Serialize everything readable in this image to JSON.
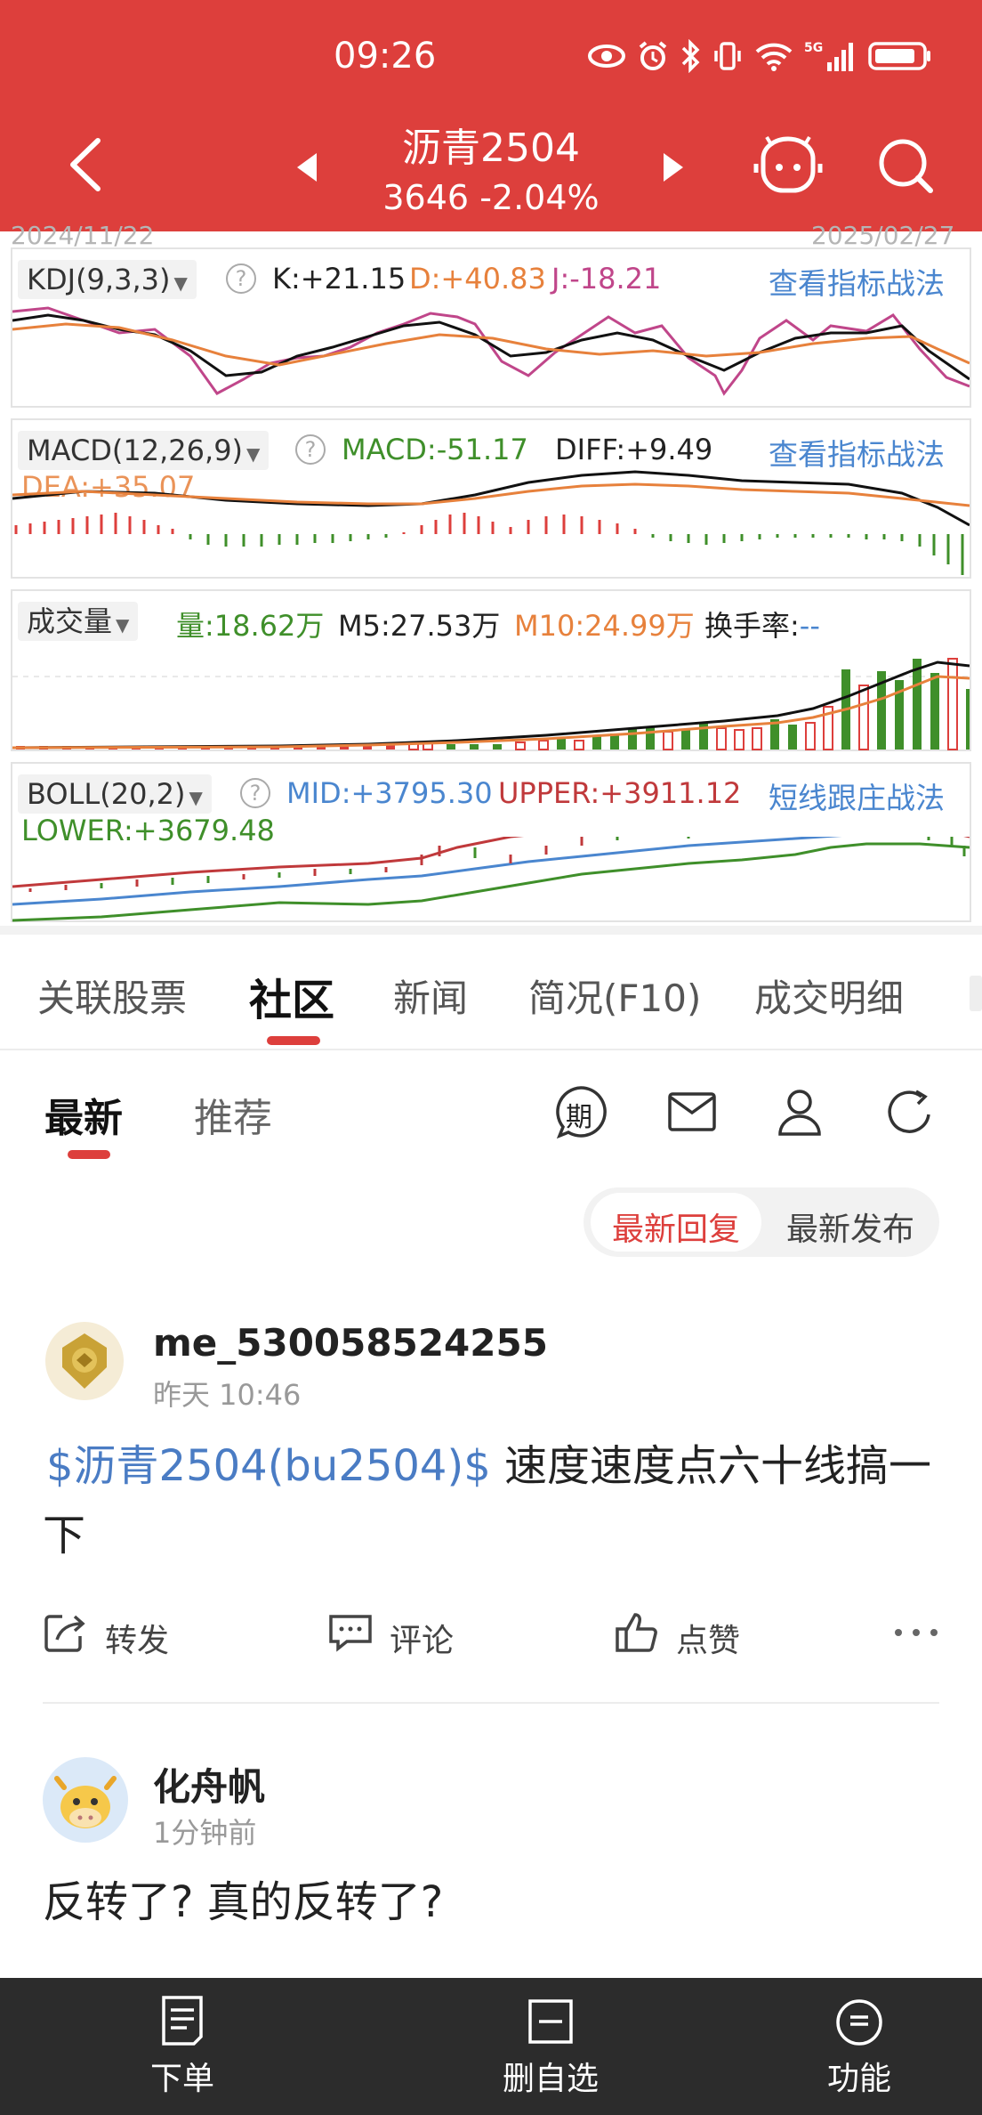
{
  "status_bar": {
    "time": "09:26",
    "icons": [
      "eye-icon",
      "alarm-icon",
      "bluetooth-icon",
      "vibrate-icon",
      "wifi-icon",
      "signal-5g-icon",
      "battery-icon"
    ]
  },
  "header": {
    "title": "沥青2504",
    "price": "3646",
    "change": "-2.04%",
    "icons": [
      "back-icon",
      "prev-icon",
      "next-icon",
      "robot-icon",
      "search-icon"
    ]
  },
  "date_range": {
    "start": "2024/11/22",
    "end": "2025/02/27"
  },
  "indicators": {
    "kdj": {
      "name": "KDJ(9,3,3)",
      "k": "K:+21.15",
      "d": "D:+40.83",
      "j": "J:-18.21",
      "link": "查看指标战法"
    },
    "macd": {
      "name": "MACD(12,26,9)",
      "macd": "MACD:-51.17",
      "diff": "DIFF:+9.49",
      "dea": "DEA:+35.07",
      "link": "查看指标战法"
    },
    "volume": {
      "name": "成交量",
      "vol": "量:18.62万",
      "m5": "M5:27.53万",
      "m10": "M10:24.99万",
      "turnover": "换手率:",
      "turnover_value": "--"
    },
    "boll": {
      "name": "BOLL(20,2)",
      "mid": "MID:+3795.30",
      "upper": "UPPER:+3911.12",
      "lower": "LOWER:+3679.48",
      "link": "短线跟庄战法"
    }
  },
  "tabs": [
    "关联股票",
    "社区",
    "新闻",
    "简况(F10)",
    "成交明细"
  ],
  "active_tab": "社区",
  "subtabs": [
    "最新",
    "推荐"
  ],
  "active_subtab": "最新",
  "toolbar_icons": [
    "period-icon",
    "mail-icon",
    "user-icon",
    "refresh-icon"
  ],
  "period_badge": "期",
  "sort_options": [
    "最新回复",
    "最新发布"
  ],
  "active_sort": "最新回复",
  "posts": [
    {
      "user": "me_530058524255",
      "time": "昨天 10:46",
      "stock_tag": "$沥青2504(bu2504)$",
      "text": "速度速度点六十线搞一",
      "text_cont": "下",
      "actions": {
        "share": "转发",
        "comment": "评论",
        "like": "点赞"
      }
    },
    {
      "user": "化舟帆",
      "time": "1分钟前",
      "text": "反转了? 真的反转了?"
    }
  ],
  "bottom_bar": {
    "order": "下单",
    "remove_watch": "删自选",
    "functions": "功能"
  },
  "colors": {
    "brand_red": "#dd3f3c",
    "link_blue": "#4a86cf",
    "green": "#3f8f2a",
    "orange": "#e7813c",
    "pink": "#c0468a"
  }
}
